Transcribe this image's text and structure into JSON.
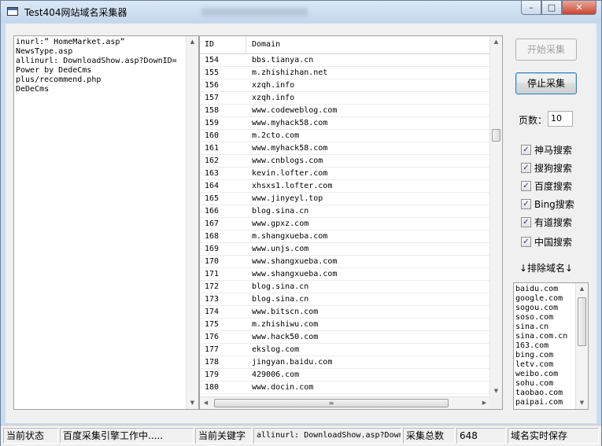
{
  "window": {
    "title": "Test404网站域名采集器",
    "controls": {
      "minimize": "–",
      "maximize": "□",
      "close": "✕"
    }
  },
  "keywords": {
    "text": "inurl:” HomeMarket.asp”\nNewsType.asp\nallinurl: DownloadShow.asp?DownID=\nPower by DedeCms\nplus/recommend.php\nDeDeCms"
  },
  "grid": {
    "columns": {
      "id": "ID",
      "domain": "Domain"
    },
    "rows": [
      {
        "id": "154",
        "domain": "bbs.tianya.cn"
      },
      {
        "id": "155",
        "domain": "m.zhishizhan.net"
      },
      {
        "id": "156",
        "domain": "xzqh.info"
      },
      {
        "id": "157",
        "domain": "xzqh.info"
      },
      {
        "id": "158",
        "domain": "www.codeweblog.com"
      },
      {
        "id": "159",
        "domain": "www.myhack58.com"
      },
      {
        "id": "160",
        "domain": "m.2cto.com"
      },
      {
        "id": "161",
        "domain": "www.myhack58.com"
      },
      {
        "id": "162",
        "domain": "www.cnblogs.com"
      },
      {
        "id": "163",
        "domain": "kevin.lofter.com"
      },
      {
        "id": "164",
        "domain": "xhsxs1.lofter.com"
      },
      {
        "id": "165",
        "domain": "www.jinyeyl.top"
      },
      {
        "id": "166",
        "domain": "blog.sina.cn"
      },
      {
        "id": "167",
        "domain": "www.gpxz.com"
      },
      {
        "id": "168",
        "domain": "m.shangxueba.com"
      },
      {
        "id": "169",
        "domain": "www.unjs.com"
      },
      {
        "id": "170",
        "domain": "www.shangxueba.com"
      },
      {
        "id": "171",
        "domain": "www.shangxueba.com"
      },
      {
        "id": "172",
        "domain": "blog.sina.cn"
      },
      {
        "id": "173",
        "domain": "blog.sina.cn"
      },
      {
        "id": "174",
        "domain": "www.bitscn.com"
      },
      {
        "id": "175",
        "domain": "m.zhishiwu.com"
      },
      {
        "id": "176",
        "domain": "www.hack50.com"
      },
      {
        "id": "177",
        "domain": "ekslog.com"
      },
      {
        "id": "178",
        "domain": "jingyan.baidu.com"
      },
      {
        "id": "179",
        "domain": "429006.com"
      },
      {
        "id": "180",
        "domain": "www.docin.com"
      }
    ],
    "hscroll_grip": "≡"
  },
  "controls": {
    "start_label": "开始采集",
    "stop_label": "停止采集",
    "pages_label": "页数：",
    "pages_value": "10",
    "engines": [
      {
        "label": "神马搜索",
        "checked": true
      },
      {
        "label": "搜狗搜索",
        "checked": true
      },
      {
        "label": "百度搜索",
        "checked": true
      },
      {
        "label": "Bing搜索",
        "checked": true
      },
      {
        "label": "有道搜索",
        "checked": true
      },
      {
        "label": "中国搜索",
        "checked": true
      }
    ],
    "exclude_label": "↓排除域名↓",
    "exclude_text": "baidu.com\ngoogle.com\nsogou.com\nsoso.com\nsina.cn\nsina.com.cn\n163.com\nbing.com\nletv.com\nweibo.com\nsohu.com\ntaobao.com\npaipai.com"
  },
  "statusbar": {
    "state_label": "当前状态",
    "state_value": "百度采集引擎工作中.....",
    "keyword_label": "当前关键字",
    "keyword_value": "allinurl: DownloadShow.asp?DownID=",
    "total_label": "采集总数",
    "total_value": "648",
    "save_label": "域名实时保存"
  }
}
